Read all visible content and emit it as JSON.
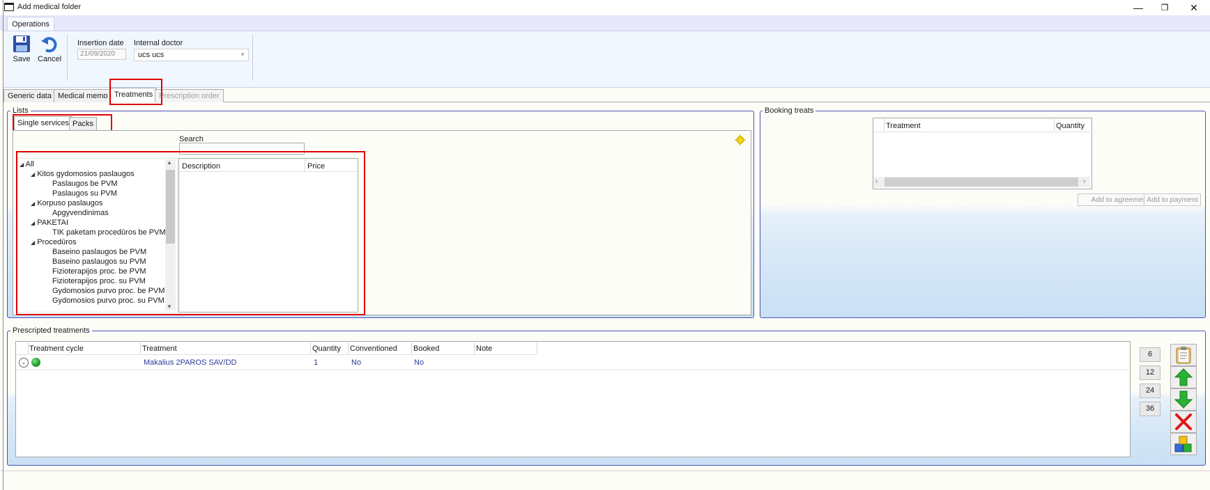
{
  "window": {
    "title": "Add medical folder",
    "minimize": "—",
    "restore": "❐",
    "close": "✕"
  },
  "ribbon": {
    "tab": "Operations",
    "save_label": "Save",
    "cancel_label": "Cancel",
    "insertion_date_label": "Insertion date",
    "insertion_date_value": "21/09/2020",
    "internal_doctor_label": "Internal doctor",
    "internal_doctor_value": "ucs ucs"
  },
  "main_tabs": [
    "Generic data",
    "Medical memo",
    "Treatments",
    "Prescription order"
  ],
  "lists": {
    "title": "Lists",
    "subtabs": [
      "Single services",
      "Packs"
    ],
    "search_label": "Search",
    "search_value": "",
    "tree": [
      {
        "label": "All",
        "expanded": true
      },
      {
        "label": "Kitos gydomosios paslaugos",
        "expanded": true
      },
      {
        "label": "Paslaugos be PVM"
      },
      {
        "label": "Paslaugos su PVM"
      },
      {
        "label": "Korpuso paslaugos",
        "expanded": true
      },
      {
        "label": "Apgyvendinimas"
      },
      {
        "label": "PAKETAI",
        "expanded": true
      },
      {
        "label": "TIK paketam procedūros be PVM"
      },
      {
        "label": "Procedūros",
        "expanded": true
      },
      {
        "label": "Baseino paslaugos be PVM"
      },
      {
        "label": "Baseino paslaugos su PVM"
      },
      {
        "label": "Fizioterapijos proc. be PVM"
      },
      {
        "label": "Fizioterapijos proc. su PVM"
      },
      {
        "label": "Gydomosios purvo proc. be PVM"
      },
      {
        "label": "Gydomosios purvo proc. su PVM"
      }
    ],
    "columns": [
      "Description",
      "Price"
    ]
  },
  "booking": {
    "title": "Booking treats",
    "columns": [
      "Treatment",
      "Quantity"
    ],
    "add_to_agreement": "Add to agreement",
    "add_to_payment": "Add to payment"
  },
  "prescripted": {
    "title": "Prescripted treatments",
    "columns": [
      "Treatment cycle",
      "Treatment",
      "Quantity",
      "Conventioned",
      "Booked",
      "Note"
    ],
    "rows": [
      {
        "treatment": "Makalius 2PAROS SAV/DD",
        "quantity": "1",
        "conventioned": "No",
        "booked": "No",
        "note": ""
      }
    ],
    "counts": [
      "6",
      "12",
      "24",
      "36"
    ]
  },
  "icons": {
    "save": "floppy-disk-icon",
    "cancel": "undo-arrow-icon",
    "refresh": "sun-refresh-icon",
    "clipboard": "clipboard-icon",
    "up": "green-up-arrow-icon",
    "down": "green-down-arrow-icon",
    "delete": "red-x-icon",
    "cubes": "blocks-icon"
  },
  "colors": {
    "accent_border": "#4b4fb5",
    "highlight": "#e00000",
    "link_text": "#2a3c9a",
    "status_green": "#1e9a2a"
  }
}
